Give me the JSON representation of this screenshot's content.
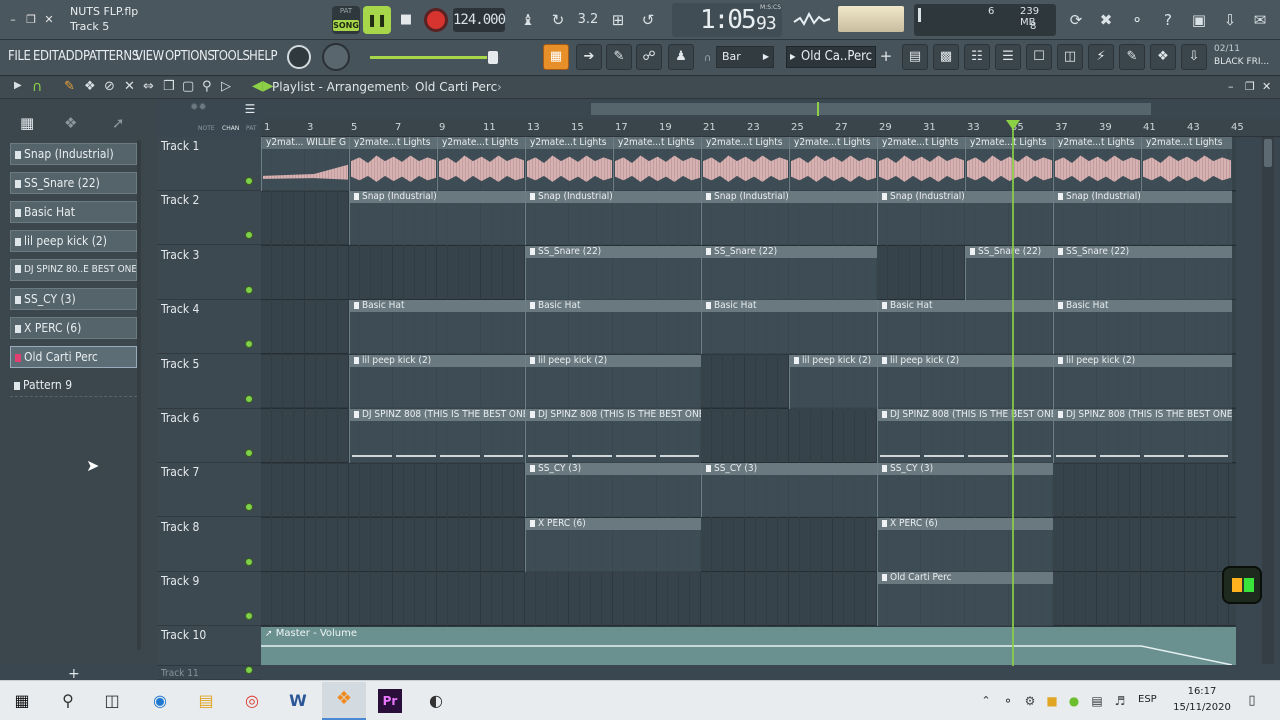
{
  "window": {
    "file_name": "NUTS FLP.flp",
    "hint_panel": "Track 5"
  },
  "transport": {
    "mode_label": "SONG",
    "mode_small": "PAT",
    "tempo": "124.000",
    "time_main": "1:05",
    "time_sub": "93",
    "time_format": "M:S:CS",
    "memory": "239 MB",
    "cpu_value": "6",
    "poly_value": "8"
  },
  "menu": [
    "FILE",
    "EDIT",
    "ADD",
    "PATTERNS",
    "VIEW",
    "OPTIONS",
    "TOOLS",
    "HELP"
  ],
  "toolbar": {
    "snap_value": "Bar",
    "pattern_selector": "Old Ca..Perc",
    "news_line1": "02/11",
    "news_line2": "BLACK FRI..."
  },
  "playlist": {
    "title": "Playlist - Arrangement",
    "pattern_crumb": "Old Carti Perc",
    "ruler_labels": [
      "NOTE",
      "CHAN",
      "PAT"
    ]
  },
  "patterns": [
    {
      "name": "Snap (Industrial)"
    },
    {
      "name": "SS_Snare (22)"
    },
    {
      "name": "Basic Hat"
    },
    {
      "name": "lil peep kick  (2)"
    },
    {
      "name": "DJ SPINZ 80..E BEST ONE)"
    },
    {
      "name": "SS_CY (3)"
    },
    {
      "name": "X PERC (6)"
    },
    {
      "name": "Old Carti Perc"
    },
    {
      "name": "Pattern 9"
    }
  ],
  "tracks": [
    "Track 1",
    "Track 2",
    "Track 3",
    "Track 4",
    "Track 5",
    "Track 6",
    "Track 7",
    "Track 8",
    "Track 9",
    "Track 10",
    "Track 11"
  ],
  "bars": [
    "1",
    "3",
    "5",
    "7",
    "9",
    "11",
    "13",
    "15",
    "17",
    "19",
    "21",
    "23",
    "25",
    "27",
    "29",
    "31",
    "33",
    "35",
    "37",
    "39",
    "41",
    "43",
    "45"
  ],
  "clips": {
    "audio_first": "y2mat... WILLIE G",
    "audio": "y2mate...t Lights",
    "snap": "Snap (Industrial)",
    "snare": "SS_Snare (22)",
    "hat": "Basic Hat",
    "kick": "lil peep kick  (2)",
    "spinz": "DJ SPINZ 808 (THIS IS THE BEST ONE)",
    "cy": "SS_CY (3)",
    "perc": "X PERC (6)",
    "carti": "Old Carti Perc",
    "automation": "Master - Volume"
  },
  "taskbar": {
    "language": "ESP",
    "time": "16:17",
    "date": "15/11/2020"
  },
  "colors": {
    "accent_green": "#8bd045",
    "record_red": "#d7332f",
    "clip_audio": "#d8b2b2",
    "automation": "#6a9090"
  }
}
